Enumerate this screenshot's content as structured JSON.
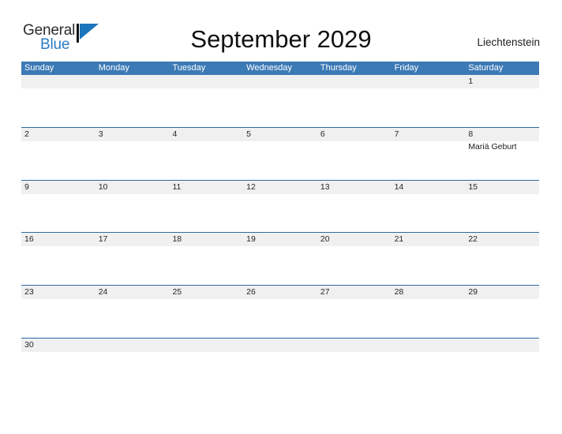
{
  "branding": {
    "name_part1": "General",
    "name_part2": "Blue",
    "flag_icon": "flag-icon",
    "brand_dark": "#2b2b2b",
    "brand_blue": "#2b7cc4"
  },
  "header": {
    "title": "September 2029",
    "region": "Liechtenstein",
    "header_bar_color": "#3c7ab6",
    "row_divider_color": "#2c6ca4",
    "date_band_color": "#f0f0f0"
  },
  "weekdays": [
    "Sunday",
    "Monday",
    "Tuesday",
    "Wednesday",
    "Thursday",
    "Friday",
    "Saturday"
  ],
  "weeks": [
    [
      {
        "day": ""
      },
      {
        "day": ""
      },
      {
        "day": ""
      },
      {
        "day": ""
      },
      {
        "day": ""
      },
      {
        "day": ""
      },
      {
        "day": "1"
      }
    ],
    [
      {
        "day": "2"
      },
      {
        "day": "3"
      },
      {
        "day": "4"
      },
      {
        "day": "5"
      },
      {
        "day": "6"
      },
      {
        "day": "7"
      },
      {
        "day": "8",
        "event": "Mariä Geburt"
      }
    ],
    [
      {
        "day": "9"
      },
      {
        "day": "10"
      },
      {
        "day": "11"
      },
      {
        "day": "12"
      },
      {
        "day": "13"
      },
      {
        "day": "14"
      },
      {
        "day": "15"
      }
    ],
    [
      {
        "day": "16"
      },
      {
        "day": "17"
      },
      {
        "day": "18"
      },
      {
        "day": "19"
      },
      {
        "day": "20"
      },
      {
        "day": "21"
      },
      {
        "day": "22"
      }
    ],
    [
      {
        "day": "23"
      },
      {
        "day": "24"
      },
      {
        "day": "25"
      },
      {
        "day": "26"
      },
      {
        "day": "27"
      },
      {
        "day": "28"
      },
      {
        "day": "29"
      }
    ],
    [
      {
        "day": "30"
      },
      {
        "day": ""
      },
      {
        "day": ""
      },
      {
        "day": ""
      },
      {
        "day": ""
      },
      {
        "day": ""
      },
      {
        "day": ""
      }
    ]
  ]
}
